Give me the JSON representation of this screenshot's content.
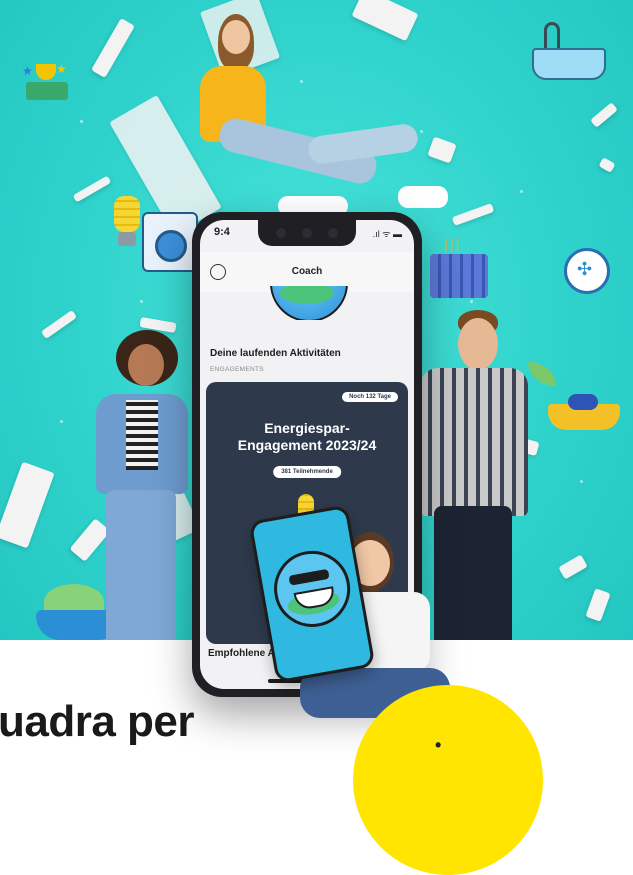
{
  "phone": {
    "status_time": "9:4",
    "status_icons": ".ıl ᯤ ▬",
    "header_title": "Coach",
    "section_title": "Deine laufenden Aktivitäten",
    "section_sub": "ENGAGEMENTS",
    "card": {
      "days_badge": "Noch 132 Tage",
      "title": "Energiespar-\nEngagement 2023/24",
      "participants": "381 Teilnehmende"
    },
    "recommended": "Empfohlene Akt"
  },
  "headline": "uadra per",
  "circle_text": "•",
  "colors": {
    "background_teal": "#2fd3cc",
    "card_navy": "#2e3a4c",
    "accent_yellow": "#ffe500"
  }
}
